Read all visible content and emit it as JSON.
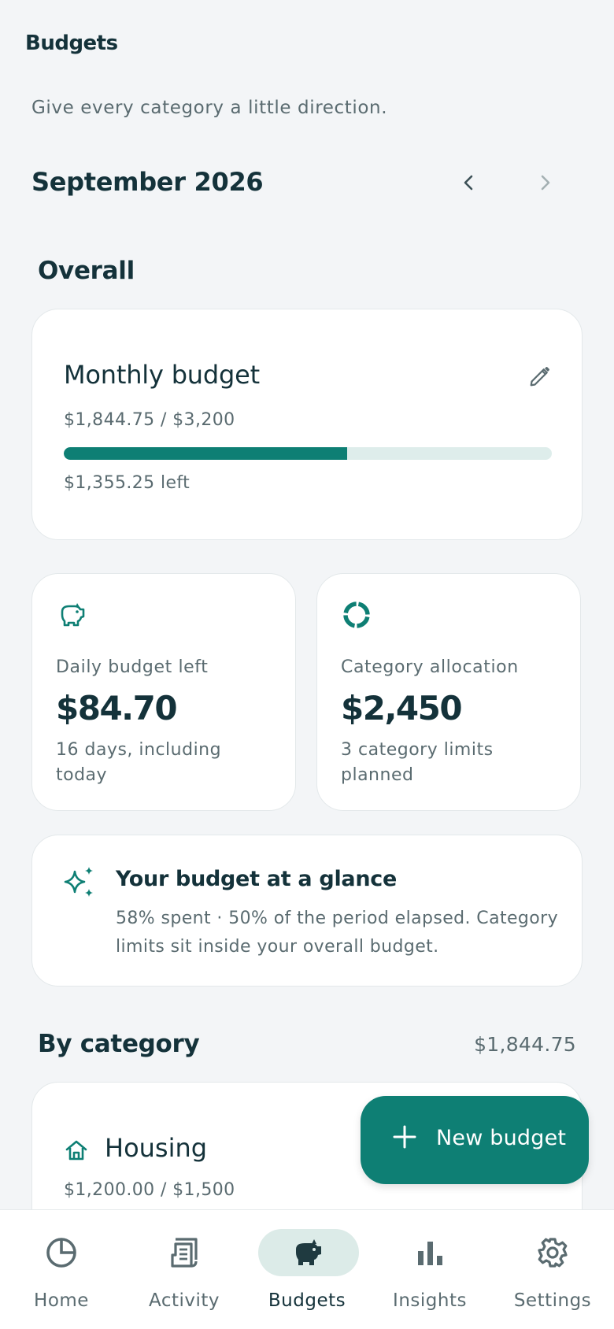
{
  "header": {
    "app_title": "Budgets",
    "subtitle": "Give every category a little direction."
  },
  "period": {
    "label": "September 2026",
    "prev_icon": "chevron-left-icon",
    "next_icon": "chevron-right-icon"
  },
  "overall": {
    "section_title": "Overall",
    "monthly_budget": {
      "title": "Monthly budget",
      "amount_text": "$1,844.75 / $3,200",
      "left_text": "$1,355.25 left",
      "progress_fraction": 0.58,
      "edit_icon": "pencil-icon"
    },
    "daily": {
      "icon": "piggy-bank-icon",
      "label": "Daily budget left",
      "value": "$84.70",
      "sub": "16 days, including today"
    },
    "allocation": {
      "icon": "donut-chart-icon",
      "label": "Category allocation",
      "value": "$2,450",
      "sub": "3 category limits planned"
    },
    "glance": {
      "icon": "sparkles-icon",
      "title": "Your budget at a glance",
      "body": "58% spent · 50% of the period elapsed. Category limits sit inside your overall budget."
    }
  },
  "by_category": {
    "section_title": "By category",
    "total": "$1,844.75",
    "items": [
      {
        "icon": "home-icon",
        "name": "Housing",
        "amount_text": "$1,200.00 / $1,500"
      }
    ]
  },
  "fab": {
    "label": "New budget",
    "icon": "plus-icon"
  },
  "bottom_nav": {
    "items": [
      {
        "label": "Home",
        "icon": "pie-chart-icon",
        "active": false
      },
      {
        "label": "Activity",
        "icon": "receipt-icon",
        "active": false
      },
      {
        "label": "Budgets",
        "icon": "piggy-bank-icon",
        "active": true
      },
      {
        "label": "Insights",
        "icon": "bar-chart-icon",
        "active": false
      },
      {
        "label": "Settings",
        "icon": "gear-icon",
        "active": false
      }
    ]
  },
  "colors": {
    "accent": "#0e7f74",
    "accent_light": "#deedeb",
    "background": "#f3f5f7",
    "text_primary": "#14323a",
    "text_secondary": "#5a6b70"
  }
}
